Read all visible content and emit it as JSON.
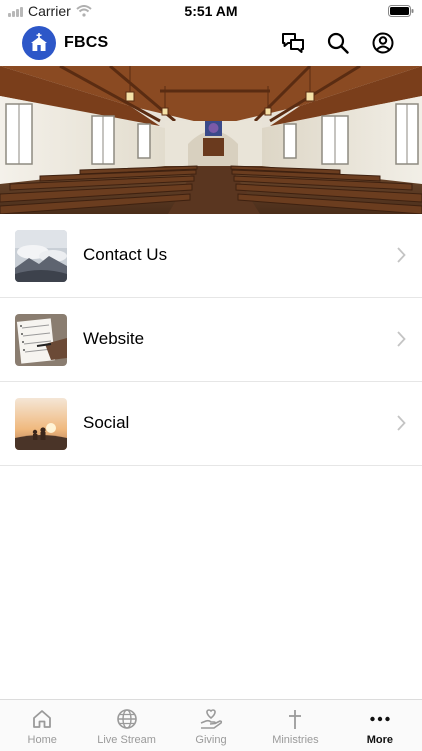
{
  "status_bar": {
    "carrier": "Carrier",
    "time": "5:51 AM"
  },
  "header": {
    "brand": "FBCS",
    "accent_color": "#2d57c8"
  },
  "menu": [
    {
      "label": "Contact Us",
      "thumb": "clouds-photo"
    },
    {
      "label": "Website",
      "thumb": "notebook-photo"
    },
    {
      "label": "Social",
      "thumb": "sunset-people-photo"
    }
  ],
  "tabs": [
    {
      "label": "Home",
      "icon": "home-icon"
    },
    {
      "label": "Live Stream",
      "icon": "globe-icon"
    },
    {
      "label": "Giving",
      "icon": "giving-hand-icon"
    },
    {
      "label": "Ministries",
      "icon": "cross-icon"
    },
    {
      "label": "More",
      "icon": "more-dots-icon",
      "active": true
    }
  ]
}
